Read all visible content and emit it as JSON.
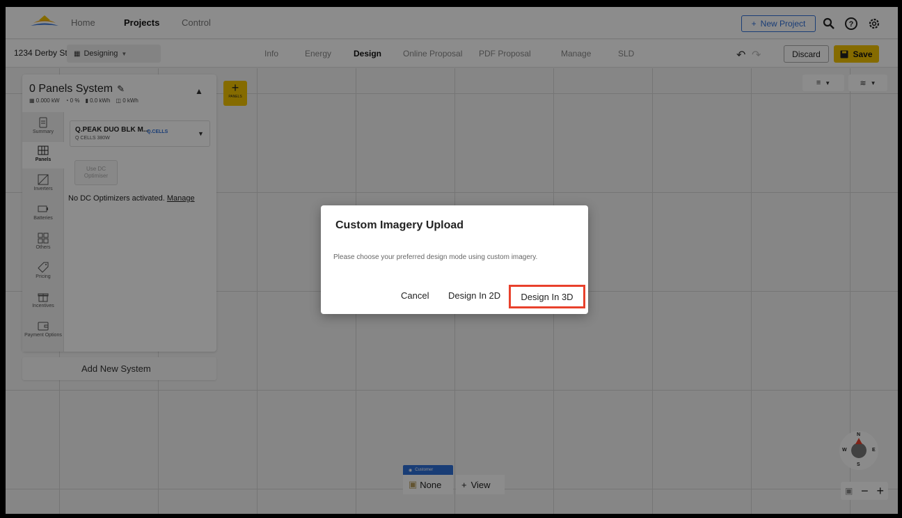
{
  "topnav": {
    "items": [
      "Home",
      "Projects",
      "Control"
    ],
    "active": "Projects",
    "new_project_label": "New Project",
    "new_project_icon": "+",
    "icons": [
      "search-icon",
      "help-icon",
      "settings-icon"
    ]
  },
  "subbar": {
    "address": "1234 Derby St",
    "status": "Designing",
    "tabs": [
      "Info",
      "Energy",
      "Design",
      "Online Proposal",
      "PDF Proposal",
      "Manage",
      "SLD"
    ],
    "active_tab": "Design",
    "discard_label": "Discard",
    "save_label": "Save"
  },
  "system": {
    "title": "0 Panels System",
    "stats": {
      "kw": "0.000 kW",
      "offset": "0 %",
      "battery": "0.0 kWh",
      "export": "0 kWh"
    },
    "nav": [
      "Summary",
      "Panels",
      "Inverters",
      "Batteries",
      "Others",
      "Pricing",
      "Incentives",
      "Payment Options"
    ],
    "active_nav": "Panels",
    "module": {
      "name": "Q.PEAK DUO BLK M...",
      "sub": "Q CELLS 380W",
      "brand": "Q.CELLS"
    },
    "dc_button": "Use DC Optimiser",
    "dc_text": "No DC Optimizers activated.",
    "dc_link": "Manage",
    "add_system": "Add New System"
  },
  "canvas": {
    "panels_plus": "+",
    "panels_label": "PANELS",
    "customer_tag": "Customer",
    "none_label": "None",
    "view_label": "View",
    "view_icon": "+",
    "compass": {
      "n": "N",
      "s": "S",
      "w": "W",
      "e": "E"
    },
    "zoom_out": "−",
    "zoom_in": "+"
  },
  "dialog": {
    "title": "Custom Imagery Upload",
    "message": "Please choose your preferred design mode using custom imagery.",
    "cancel": "Cancel",
    "design_2d": "Design In 2D",
    "design_3d": "Design In 3D"
  },
  "colors": {
    "accent_blue": "#2f6fd8",
    "save_yellow": "#f2c300",
    "highlight_red": "#e8412c"
  }
}
